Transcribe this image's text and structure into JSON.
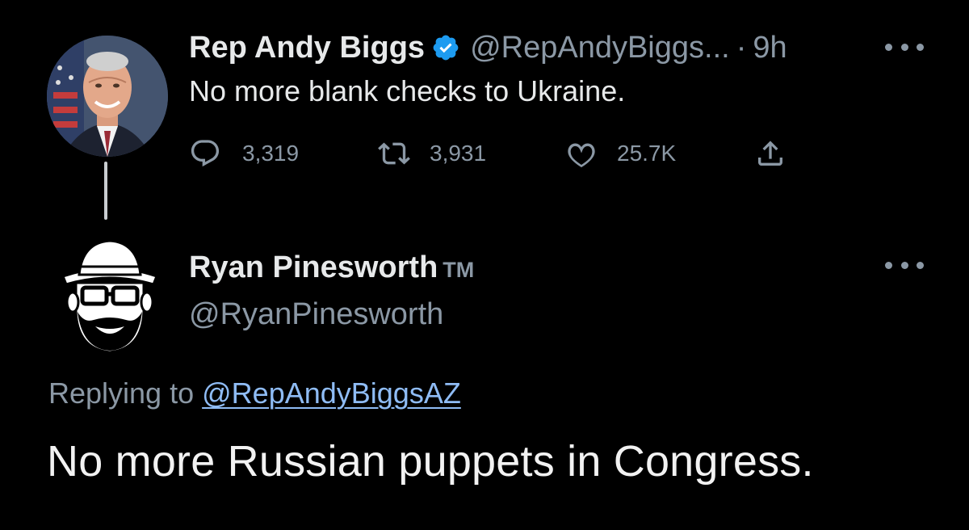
{
  "parent_tweet": {
    "author_name": "Rep Andy Biggs",
    "verified": true,
    "handle": "@RepAndyBiggs...",
    "separator": "·",
    "time": "9h",
    "text": "No more blank checks to Ukraine.",
    "actions": {
      "replies": "3,319",
      "retweets": "3,931",
      "likes": "25.7K"
    },
    "icons": [
      "reply-icon",
      "retweet-icon",
      "like-icon",
      "share-icon",
      "more-icon"
    ]
  },
  "reply_tweet": {
    "author_name": "Ryan Pinesworth",
    "author_suffix": "TM",
    "handle": "@RyanPinesworth",
    "replying_prefix": "Replying to",
    "replying_to": "@RepAndyBiggsAZ",
    "text": "No more Russian puppets in Congress."
  },
  "colors": {
    "background": "#000000",
    "primary_text": "#e7e9ea",
    "secondary_text": "#8b98a5",
    "link": "#8fbcf5",
    "verified_badge": "#1d9bf0"
  }
}
